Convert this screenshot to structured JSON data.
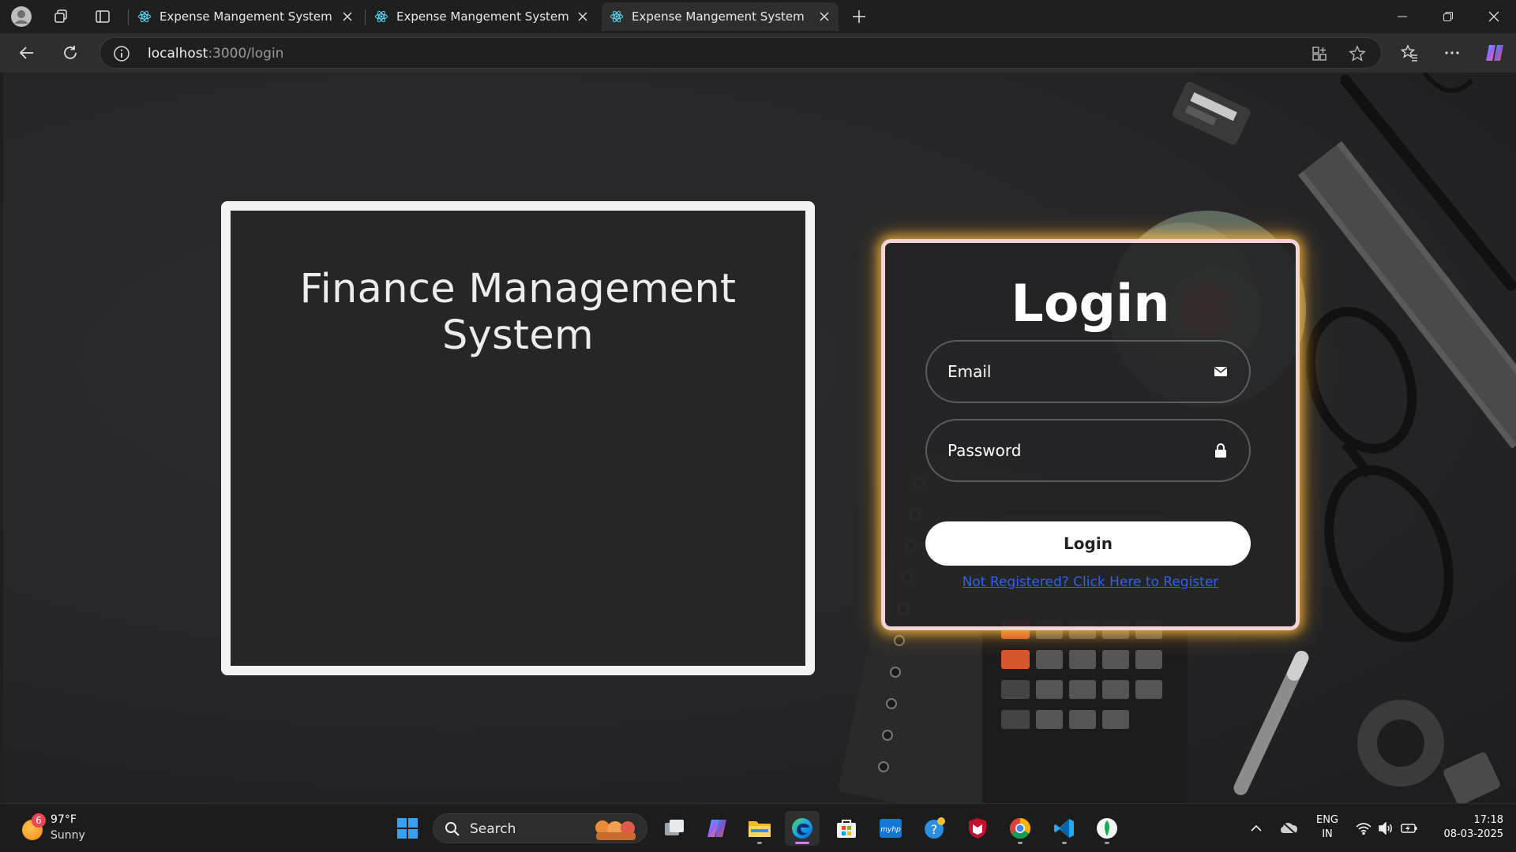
{
  "browser": {
    "tabs": [
      {
        "title": "Expense Mangement System",
        "active": false
      },
      {
        "title": "Expense Mangement System",
        "active": false
      },
      {
        "title": "Expense Mangement System",
        "active": true
      }
    ],
    "address": {
      "host": "localhost",
      "rest": ":3000/login"
    }
  },
  "page": {
    "finance_title": "Finance Management System",
    "login": {
      "title": "Login",
      "email_placeholder": "Email",
      "password_placeholder": "Password",
      "button_label": "Login",
      "register_link": "Not Registered? Click Here to Register"
    }
  },
  "taskbar": {
    "weather": {
      "badge": "6",
      "temp": "97°F",
      "condition": "Sunny"
    },
    "search_label": "Search",
    "lang_line1": "ENG",
    "lang_line2": "IN",
    "time": "17:18",
    "date": "08-03-2025"
  },
  "colors": {
    "link": "#2f62e8",
    "card_glow": "#ffbe3c",
    "edge_active_indicator": "#d079f0"
  }
}
